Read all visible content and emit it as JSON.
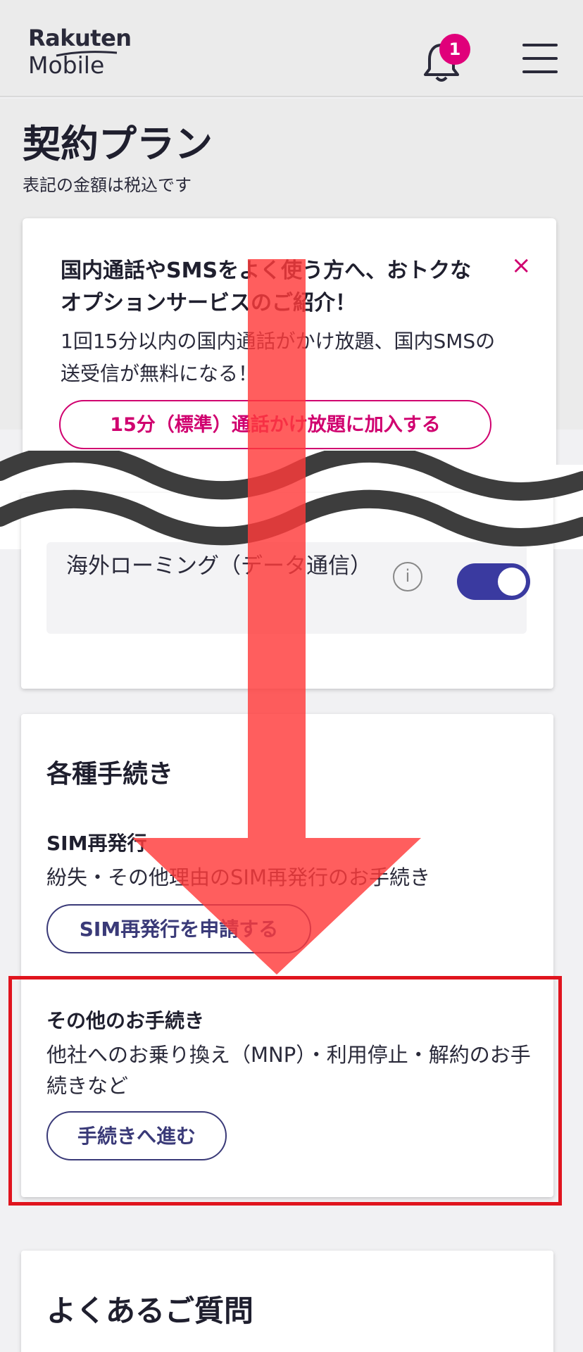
{
  "header": {
    "logo_line1": "Rakuten",
    "logo_line2": "Mobile",
    "notification_count": "1"
  },
  "page": {
    "title": "契約プラン",
    "tax_note": "表記の金額は税込です"
  },
  "promo": {
    "title": "国内通話やSMSをよく使う方へ、おトクなオプションサービスのご紹介！",
    "close": "×",
    "body": "1回15分以内の国内通話がかけ放題、国内SMSの送受信が無料になる！",
    "button": "15分（標準）通話かけ放題に加入する"
  },
  "roaming": {
    "label": "海外ローミング（データ通信）",
    "info": "i",
    "enabled": true
  },
  "procedures": {
    "title": "各種手続き",
    "sim": {
      "title": "SIM再発行",
      "desc": "紛失・その他理由のSIM再発行のお手続き",
      "button": "SIM再発行を申請する"
    },
    "other": {
      "title": "その他のお手続き",
      "desc": "他社へのお乗り換え（MNP）・利用停止・解約のお手続きなど",
      "button": "手続きへ進む"
    }
  },
  "faq": {
    "title": "よくあるご質問"
  },
  "colors": {
    "brand": "#e0007a",
    "accent": "#3a3aa0",
    "highlight": "#e0141e",
    "arrow": "#ff4040"
  }
}
